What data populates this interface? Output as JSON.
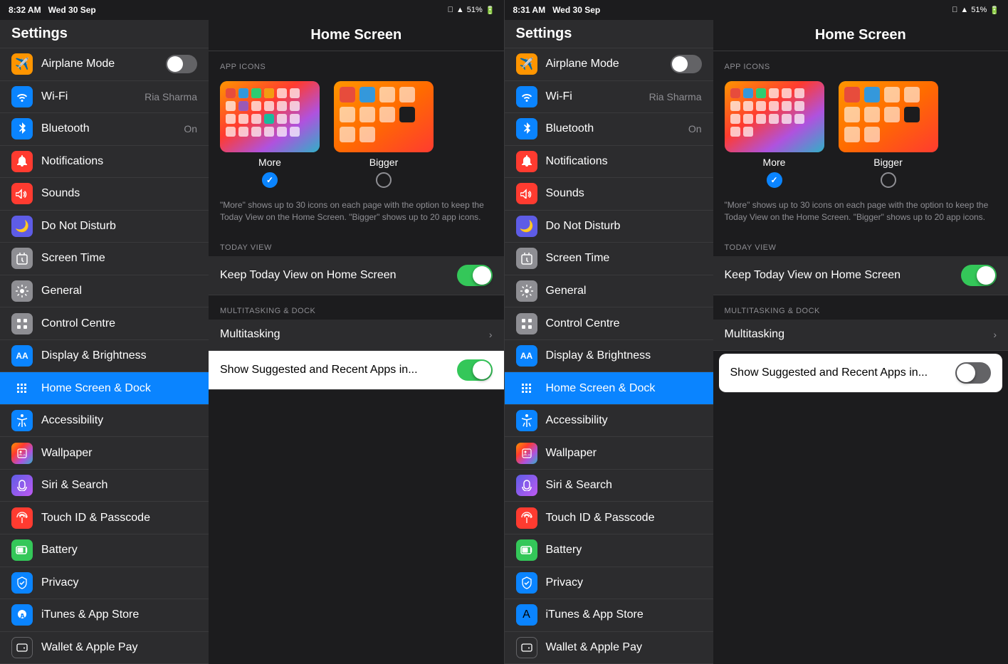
{
  "panels": [
    {
      "id": "left",
      "statusBar": {
        "time": "8:32 AM",
        "date": "Wed 30 Sep",
        "signal": "●●●",
        "wifi": "WiFi",
        "battery": "51%"
      },
      "sidebar": {
        "title": "Settings",
        "items": [
          {
            "id": "airplane-mode",
            "label": "Airplane Mode",
            "icon": "✈",
            "iconBg": "#ff9500",
            "value": "",
            "hasToggle": true,
            "toggleOn": false
          },
          {
            "id": "wifi",
            "label": "Wi-Fi",
            "icon": "📶",
            "iconBg": "#0a84ff",
            "value": "Ria Sharma",
            "hasToggle": false
          },
          {
            "id": "bluetooth",
            "label": "Bluetooth",
            "icon": "🔵",
            "iconBg": "#0a84ff",
            "value": "On",
            "hasToggle": false
          },
          {
            "id": "notifications",
            "label": "Notifications",
            "icon": "🔴",
            "iconBg": "#ff3b30",
            "value": "",
            "hasToggle": false
          },
          {
            "id": "sounds",
            "label": "Sounds",
            "icon": "🔊",
            "iconBg": "#ff3b30",
            "value": "",
            "hasToggle": false
          },
          {
            "id": "do-not-disturb",
            "label": "Do Not Disturb",
            "icon": "🌙",
            "iconBg": "#5e5ce6",
            "value": "",
            "hasToggle": false
          },
          {
            "id": "screen-time",
            "label": "Screen Time",
            "icon": "⏱",
            "iconBg": "#8e8e93",
            "value": "",
            "hasToggle": false
          },
          {
            "id": "general",
            "label": "General",
            "icon": "⚙",
            "iconBg": "#8e8e93",
            "value": "",
            "hasToggle": false
          },
          {
            "id": "control-centre",
            "label": "Control Centre",
            "icon": "⊞",
            "iconBg": "#8e8e93",
            "value": "",
            "hasToggle": false
          },
          {
            "id": "display-brightness",
            "label": "Display & Brightness",
            "icon": "AA",
            "iconBg": "#0a84ff",
            "value": "",
            "hasToggle": false
          },
          {
            "id": "home-screen",
            "label": "Home Screen & Dock",
            "icon": "⊞",
            "iconBg": "#0a84ff",
            "value": "",
            "active": true,
            "hasToggle": false
          },
          {
            "id": "accessibility",
            "label": "Accessibility",
            "icon": "♿",
            "iconBg": "#0a84ff",
            "value": "",
            "hasToggle": false
          },
          {
            "id": "wallpaper",
            "label": "Wallpaper",
            "icon": "🌅",
            "iconBg": "#30b0c7",
            "value": "",
            "hasToggle": false
          },
          {
            "id": "siri-search",
            "label": "Siri & Search",
            "icon": "🔮",
            "iconBg": "#5e5ce6",
            "value": "",
            "hasToggle": false
          },
          {
            "id": "touch-id",
            "label": "Touch ID & Passcode",
            "icon": "🔒",
            "iconBg": "#ff3b30",
            "value": "",
            "hasToggle": false
          },
          {
            "id": "battery",
            "label": "Battery",
            "icon": "🔋",
            "iconBg": "#34c759",
            "value": "",
            "hasToggle": false
          },
          {
            "id": "privacy",
            "label": "Privacy",
            "icon": "🤚",
            "iconBg": "#0a84ff",
            "value": "",
            "hasToggle": false
          },
          {
            "id": "itunes",
            "label": "iTunes & App Store",
            "icon": "A",
            "iconBg": "#0a84ff",
            "value": "",
            "hasToggle": false
          },
          {
            "id": "wallet",
            "label": "Wallet & Apple Pay",
            "icon": "💳",
            "iconBg": "#1c1c1e",
            "value": "",
            "hasToggle": false
          }
        ]
      },
      "detail": {
        "title": "Home Screen",
        "appIconsLabel": "APP ICONS",
        "options": [
          {
            "id": "more",
            "label": "More",
            "selected": true
          },
          {
            "id": "bigger",
            "label": "Bigger",
            "selected": false
          }
        ],
        "description": "\"More\" shows up to 30 icons on each page with the option to keep the Today View on the Home Screen. \"Bigger\" shows up to 20 app icons.",
        "todayViewLabel": "TODAY VIEW",
        "keepTodayView": "Keep Today View on Home Screen",
        "keepTodayToggle": true,
        "multitaskingLabel": "MULTITASKING & DOCK",
        "multitasking": "Multitasking",
        "showSuggested": "Show Suggested and Recent Apps in...",
        "showSuggestedToggle": true
      }
    },
    {
      "id": "right",
      "statusBar": {
        "time": "8:31 AM",
        "date": "Wed 30 Sep",
        "signal": "●●●",
        "wifi": "WiFi",
        "battery": "51%"
      },
      "sidebar": {
        "title": "Settings",
        "items": [
          {
            "id": "airplane-mode",
            "label": "Airplane Mode",
            "icon": "✈",
            "iconBg": "#ff9500",
            "value": "",
            "hasToggle": true,
            "toggleOn": false
          },
          {
            "id": "wifi",
            "label": "Wi-Fi",
            "icon": "📶",
            "iconBg": "#0a84ff",
            "value": "Ria Sharma",
            "hasToggle": false
          },
          {
            "id": "bluetooth",
            "label": "Bluetooth",
            "icon": "🔵",
            "iconBg": "#0a84ff",
            "value": "On",
            "hasToggle": false
          },
          {
            "id": "notifications",
            "label": "Notifications",
            "icon": "🔴",
            "iconBg": "#ff3b30",
            "value": "",
            "hasToggle": false
          },
          {
            "id": "sounds",
            "label": "Sounds",
            "icon": "🔊",
            "iconBg": "#ff3b30",
            "value": "",
            "hasToggle": false
          },
          {
            "id": "do-not-disturb",
            "label": "Do Not Disturb",
            "icon": "🌙",
            "iconBg": "#5e5ce6",
            "value": "",
            "hasToggle": false
          },
          {
            "id": "screen-time",
            "label": "Screen Time",
            "icon": "⏱",
            "iconBg": "#8e8e93",
            "value": "",
            "hasToggle": false
          },
          {
            "id": "general",
            "label": "General",
            "icon": "⚙",
            "iconBg": "#8e8e93",
            "value": "",
            "hasToggle": false
          },
          {
            "id": "control-centre",
            "label": "Control Centre",
            "icon": "⊞",
            "iconBg": "#8e8e93",
            "value": "",
            "hasToggle": false
          },
          {
            "id": "display-brightness",
            "label": "Display & Brightness",
            "icon": "AA",
            "iconBg": "#0a84ff",
            "value": "",
            "hasToggle": false
          },
          {
            "id": "home-screen",
            "label": "Home Screen & Dock",
            "icon": "⊞",
            "iconBg": "#0a84ff",
            "value": "",
            "active": true,
            "hasToggle": false
          },
          {
            "id": "accessibility",
            "label": "Accessibility",
            "icon": "♿",
            "iconBg": "#0a84ff",
            "value": "",
            "hasToggle": false
          },
          {
            "id": "wallpaper",
            "label": "Wallpaper",
            "icon": "🌅",
            "iconBg": "#30b0c7",
            "value": "",
            "hasToggle": false
          },
          {
            "id": "siri-search",
            "label": "Siri & Search",
            "icon": "🔮",
            "iconBg": "#5e5ce6",
            "value": "",
            "hasToggle": false
          },
          {
            "id": "touch-id",
            "label": "Touch ID & Passcode",
            "icon": "🔒",
            "iconBg": "#ff3b30",
            "value": "",
            "hasToggle": false
          },
          {
            "id": "battery",
            "label": "Battery",
            "icon": "🔋",
            "iconBg": "#34c759",
            "value": "",
            "hasToggle": false
          },
          {
            "id": "privacy",
            "label": "Privacy",
            "icon": "🤚",
            "iconBg": "#0a84ff",
            "value": "",
            "hasToggle": false
          },
          {
            "id": "itunes",
            "label": "iTunes & App Store",
            "icon": "A",
            "iconBg": "#0a84ff",
            "value": "",
            "hasToggle": false
          },
          {
            "id": "wallet",
            "label": "Wallet & Apple Pay",
            "icon": "💳",
            "iconBg": "#1c1c1e",
            "value": "",
            "hasToggle": false
          }
        ]
      },
      "detail": {
        "title": "Home Screen",
        "appIconsLabel": "APP ICONS",
        "options": [
          {
            "id": "more",
            "label": "More",
            "selected": true
          },
          {
            "id": "bigger",
            "label": "Bigger",
            "selected": false
          }
        ],
        "description": "\"More\" shows up to 30 icons on each page with the option to keep the Today View on the Home Screen. \"Bigger\" shows up to 20 app icons.",
        "todayViewLabel": "TODAY VIEW",
        "keepTodayView": "Keep Today View on Home Screen",
        "keepTodayToggle": true,
        "multitaskingLabel": "MULTITASKING & DOCK",
        "multitasking": "Multitasking",
        "showSuggested": "Show Suggested and Recent Apps in...",
        "showSuggestedToggle": false
      }
    }
  ],
  "iconMap": {
    "airplane-mode": "#ff9500",
    "wifi": "#0a84ff",
    "bluetooth": "#0a84ff",
    "notifications": "#ff3b30",
    "sounds": "#ff3b30",
    "do-not-disturb": "#5e5ce6",
    "screen-time": "#8e8e93",
    "general": "#8e8e93",
    "control-centre": "#8e8e93",
    "display-brightness": "#0a84ff",
    "home-screen": "#0a84ff",
    "accessibility": "#0a84ff",
    "wallpaper": "#30b0c7",
    "siri-search": "#5e5ce6",
    "touch-id": "#ff3b30",
    "battery": "#34c759",
    "privacy": "#0a84ff",
    "itunes": "#0a84ff",
    "wallet": "#1c1c1e"
  }
}
